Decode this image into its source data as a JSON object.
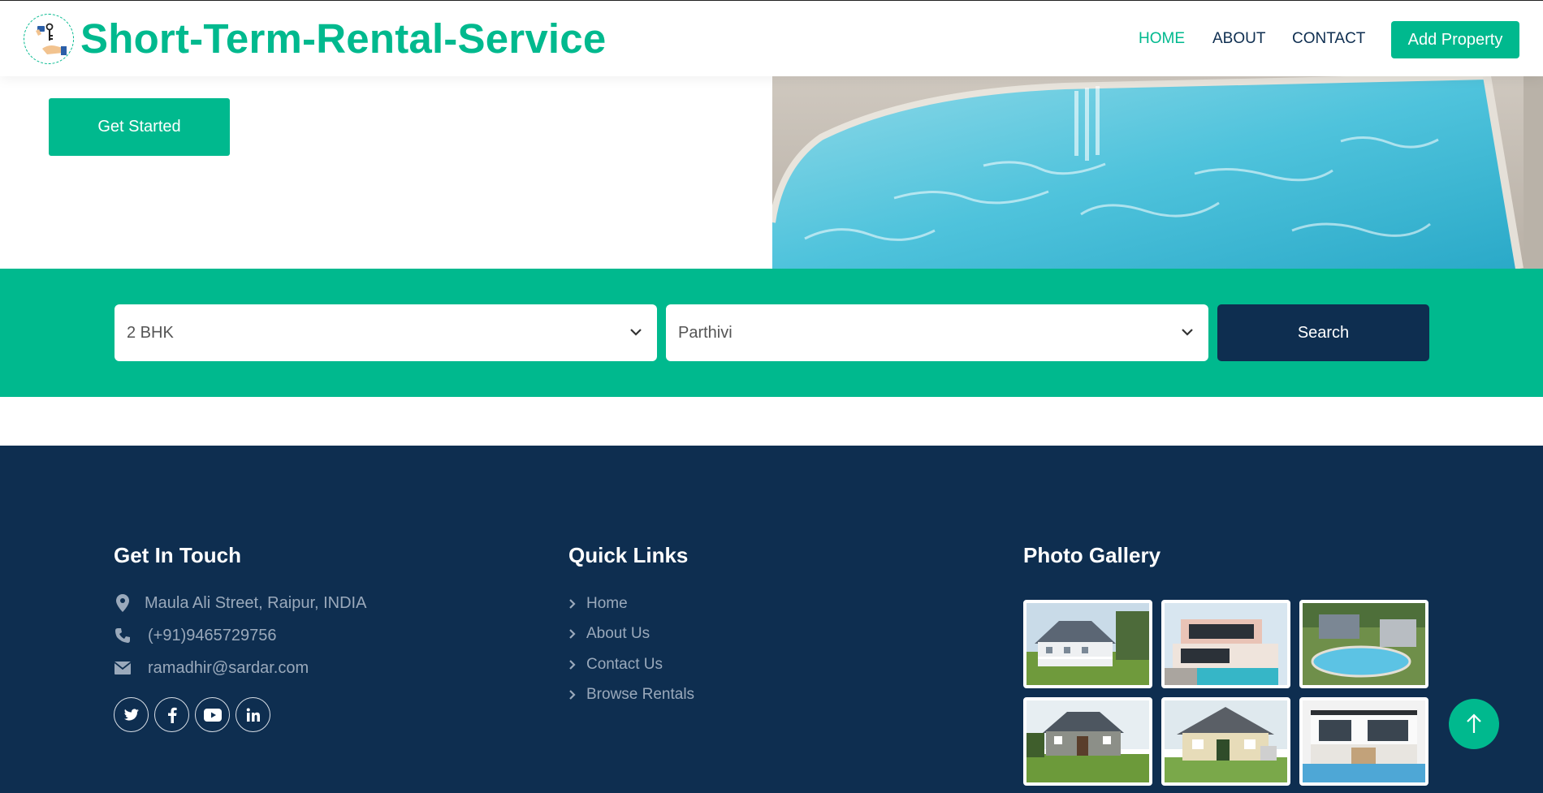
{
  "header": {
    "brand": "Short-Term-Rental-Service",
    "nav": [
      {
        "label": "HOME",
        "active": true
      },
      {
        "label": "ABOUT",
        "active": false
      },
      {
        "label": "CONTACT",
        "active": false
      }
    ],
    "add_property_label": "Add Property"
  },
  "hero": {
    "cta_label": "Get Started",
    "image_icon": "swimming-pool-photo"
  },
  "search": {
    "property_type": "2 BHK",
    "location": "Parthivi",
    "button_label": "Search"
  },
  "footer": {
    "contact": {
      "title": "Get In Touch",
      "address": "Maula Ali Street, Raipur, INDIA",
      "phone": "(+91)9465729756",
      "email": "ramadhir@sardar.com",
      "social_icons": [
        "twitter-icon",
        "facebook-icon",
        "youtube-icon",
        "linkedin-icon"
      ]
    },
    "quick_links": {
      "title": "Quick Links",
      "items": [
        "Home",
        "About Us",
        "Contact Us",
        "Browse Rentals"
      ]
    },
    "gallery": {
      "title": "Photo Gallery"
    }
  },
  "colors": {
    "accent": "#00b98e",
    "navy": "#0e2e50",
    "muted_text": "#9aa9bb"
  }
}
